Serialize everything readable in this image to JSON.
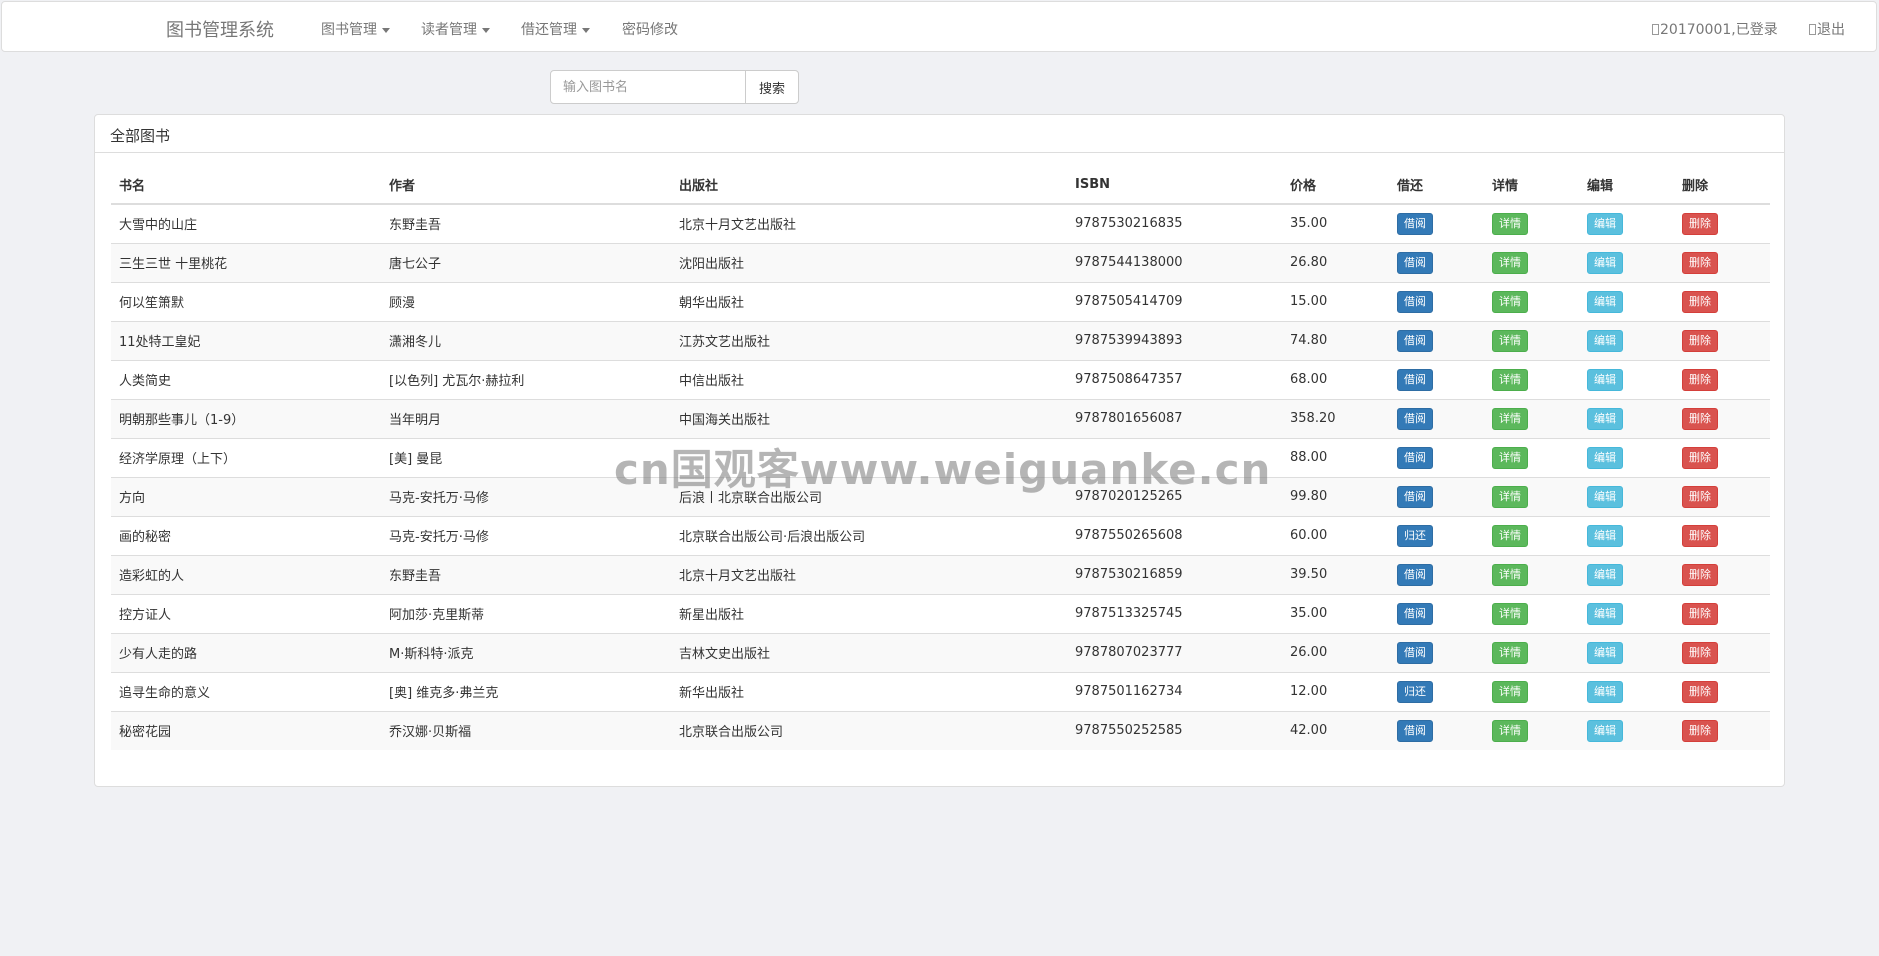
{
  "navbar": {
    "brand": "图书管理系统",
    "menus": [
      {
        "label": "图书管理",
        "dropdown": true
      },
      {
        "label": "读者管理",
        "dropdown": true
      },
      {
        "label": "借还管理",
        "dropdown": true
      },
      {
        "label": "密码修改",
        "dropdown": false
      }
    ],
    "user_status": "20170001,已登录",
    "logout": "退出"
  },
  "search": {
    "placeholder": "输入图书名",
    "button": "搜索"
  },
  "panel": {
    "title": "全部图书"
  },
  "table": {
    "headers": [
      "书名",
      "作者",
      "出版社",
      "ISBN",
      "价格",
      "借还",
      "详情",
      "编辑",
      "删除"
    ],
    "detail_label": "详情",
    "edit_label": "编辑",
    "delete_label": "删除",
    "rows": [
      {
        "title": "大雪中的山庄",
        "author": "东野圭吾",
        "publisher": "北京十月文艺出版社",
        "isbn": "9787530216835",
        "price": "35.00",
        "action": "借阅"
      },
      {
        "title": "三生三世 十里桃花",
        "author": "唐七公子",
        "publisher": "沈阳出版社",
        "isbn": "9787544138000",
        "price": "26.80",
        "action": "借阅"
      },
      {
        "title": "何以笙箫默",
        "author": "顾漫",
        "publisher": "朝华出版社",
        "isbn": "9787505414709",
        "price": "15.00",
        "action": "借阅"
      },
      {
        "title": "11处特工皇妃",
        "author": "潇湘冬儿",
        "publisher": "江苏文艺出版社",
        "isbn": "9787539943893",
        "price": "74.80",
        "action": "借阅"
      },
      {
        "title": "人类简史",
        "author": "[以色列] 尤瓦尔·赫拉利",
        "publisher": "中信出版社",
        "isbn": "9787508647357",
        "price": "68.00",
        "action": "借阅"
      },
      {
        "title": "明朝那些事儿（1-9）",
        "author": "当年明月",
        "publisher": "中国海关出版社",
        "isbn": "9787801656087",
        "price": "358.20",
        "action": "借阅"
      },
      {
        "title": "经济学原理（上下）",
        "author": "[美] 曼昆",
        "publisher": "",
        "isbn": "",
        "price": "88.00",
        "action": "借阅"
      },
      {
        "title": "方向",
        "author": "马克-安托万·马修",
        "publisher": "后浪丨北京联合出版公司",
        "isbn": "9787020125265",
        "price": "99.80",
        "action": "借阅"
      },
      {
        "title": "画的秘密",
        "author": "马克-安托万·马修",
        "publisher": "北京联合出版公司·后浪出版公司",
        "isbn": "9787550265608",
        "price": "60.00",
        "action": "归还"
      },
      {
        "title": "造彩虹的人",
        "author": "东野圭吾",
        "publisher": "北京十月文艺出版社",
        "isbn": "9787530216859",
        "price": "39.50",
        "action": "借阅"
      },
      {
        "title": "控方证人",
        "author": "阿加莎·克里斯蒂",
        "publisher": "新星出版社",
        "isbn": "9787513325745",
        "price": "35.00",
        "action": "借阅"
      },
      {
        "title": "少有人走的路",
        "author": "M·斯科特·派克",
        "publisher": "吉林文史出版社",
        "isbn": "9787807023777",
        "price": "26.00",
        "action": "借阅"
      },
      {
        "title": "追寻生命的意义",
        "author": "[奥] 维克多·弗兰克",
        "publisher": "新华出版社",
        "isbn": "9787501162734",
        "price": "12.00",
        "action": "归还"
      },
      {
        "title": "秘密花园",
        "author": "乔汉娜·贝斯福",
        "publisher": "北京联合出版公司",
        "isbn": "9787550252585",
        "price": "42.00",
        "action": "借阅"
      }
    ]
  },
  "watermark": "cn国观客www.weiguanke.cn",
  "colors": {
    "page_bg": "#f0f1f4",
    "primary": "#337ab7",
    "success": "#5cb85c",
    "info": "#5bc0de",
    "danger": "#d9534f"
  }
}
